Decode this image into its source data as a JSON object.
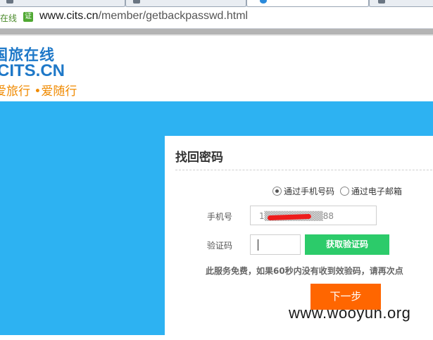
{
  "browser": {
    "site_tag": "在线",
    "cert_label": "证",
    "url_host": "www.cits.cn",
    "url_path": "/member/getbackpasswd.html"
  },
  "logo": {
    "name_cn": "国旅在线",
    "name_en": "CITS.CN",
    "slogan": "爱旅行 •爱随行"
  },
  "form": {
    "title": "找回密码",
    "radio_options": [
      {
        "label": "通过手机号码",
        "selected": true
      },
      {
        "label": "通过电子邮箱",
        "selected": false
      }
    ],
    "phone_label": "手机号",
    "phone_value": "1▒▒▒▒▒▒▒▒▒88",
    "code_label": "验证码",
    "code_value": "",
    "get_code_button": "获取验证码",
    "notice": "此服务免费，如果60秒内没有收到效验码，请再次点",
    "next_button": "下一步"
  },
  "watermark": "www.wooyun.org",
  "colors": {
    "stage_bg": "#2db2f2",
    "get_code_bg": "#2ccb6a",
    "next_bg": "#ff6600",
    "logo_blue": "#1e78c8",
    "logo_orange": "#f08a00"
  }
}
